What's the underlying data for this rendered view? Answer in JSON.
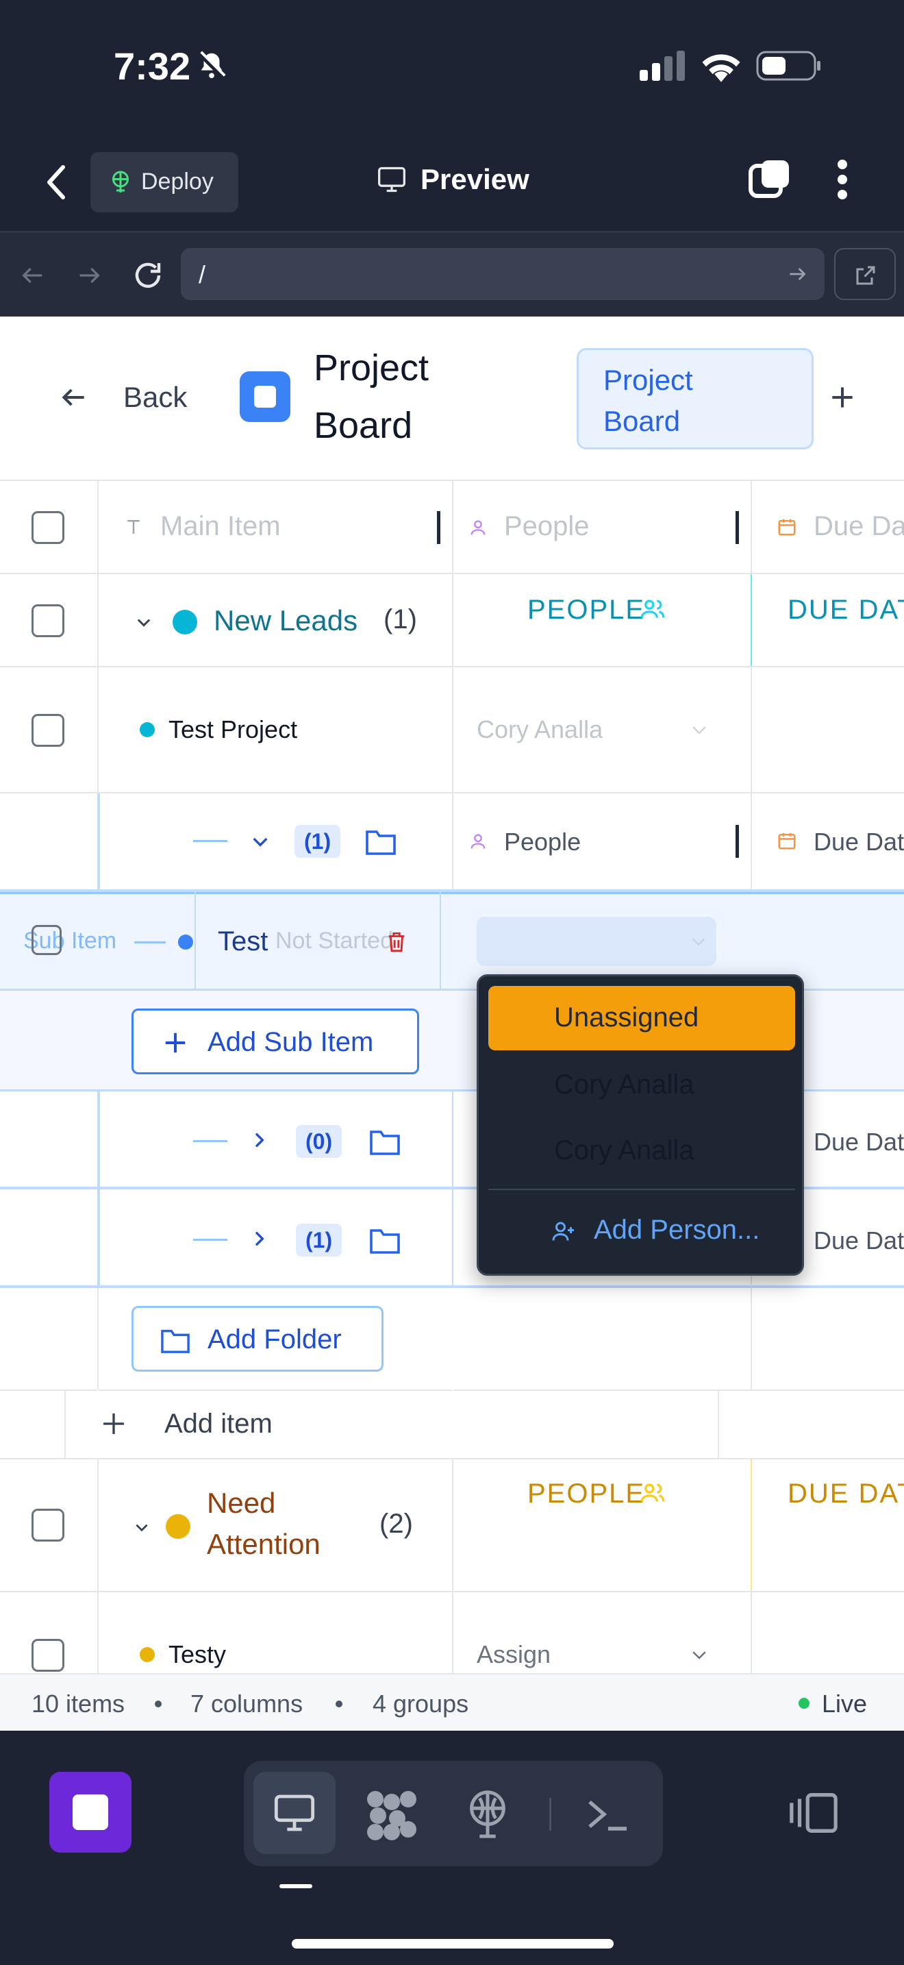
{
  "status_bar": {
    "time": "7:32"
  },
  "app_bar": {
    "deploy_label": "Deploy",
    "preview_label": "Preview"
  },
  "url_bar": {
    "path": "/"
  },
  "page": {
    "back_label": "Back",
    "title_line1": "Project",
    "title_line2": "Board",
    "view_tab_line1": "Project",
    "view_tab_line2": "Board"
  },
  "columns": {
    "main_item": "Main Item",
    "people": "People",
    "due_date": "Due Da"
  },
  "group_new_leads": {
    "name": "New Leads",
    "count": "(1)",
    "people_header": "PEOPLE",
    "due_header": "DUE DAT",
    "color": "#0891b2"
  },
  "row_test_project": {
    "name": "Test Project",
    "person": "Cory Analla"
  },
  "subheader": {
    "count": "(1)",
    "people": "People",
    "due": "Due Dat"
  },
  "sub_item_row": {
    "name": "Test",
    "ghost_text": "Sub Item",
    "status_ghost": "Not Started"
  },
  "add_sub_item_label": "Add Sub Item",
  "folder_rows": [
    {
      "count": "(0)",
      "due": "Due Dat"
    },
    {
      "count": "(1)",
      "due": "Due Dat"
    }
  ],
  "add_folder_label": "Add Folder",
  "add_item_label": "Add item",
  "group_need_attention": {
    "name_line1": "Need",
    "name_line2": "Attention",
    "count": "(2)",
    "people_header": "PEOPLE",
    "due_header": "DUE DAT",
    "color": "#a16207"
  },
  "row_testy": {
    "name": "Testy",
    "person": "Assign"
  },
  "dropdown": {
    "options": [
      "Unassigned",
      "Cory Analla",
      "Cory Analla"
    ],
    "selected": "Unassigned",
    "add_person": "Add Person..."
  },
  "footer": {
    "items": "10 items",
    "columns": "7 columns",
    "groups": "4 groups",
    "live": "Live"
  },
  "colors": {
    "accent": "#3b82f6",
    "selected_option": "#f59e0b",
    "live": "#22c55e",
    "dark_bg": "#1d2332",
    "app_icon": "#6d28d9"
  }
}
